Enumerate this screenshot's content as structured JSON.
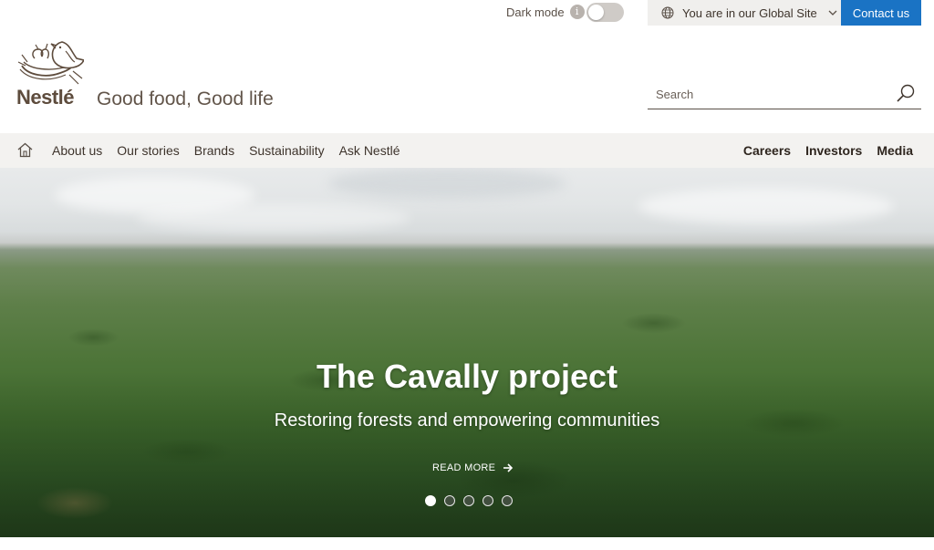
{
  "utility": {
    "dark_mode_label": "Dark mode",
    "info_glyph": "i",
    "site_label": "You are in our Global Site",
    "contact_label": "Contact us"
  },
  "header": {
    "logo_text": "Nestlé",
    "tagline": "Good food, Good life",
    "search_placeholder": "Search"
  },
  "nav": {
    "left": [
      "About us",
      "Our stories",
      "Brands",
      "Sustainability",
      "Ask Nestlé"
    ],
    "right": [
      "Careers",
      "Investors",
      "Media"
    ]
  },
  "hero": {
    "title": "The Cavally project",
    "subtitle": "Restoring forests and empowering communities",
    "read_more": "READ MORE",
    "slide_count": 5,
    "active_slide": 1
  },
  "colors": {
    "accent": "#1a73c4",
    "brand_brown": "#5e4c3d"
  },
  "icons": [
    "info-icon",
    "globe-icon",
    "chevron-down-icon",
    "search-icon",
    "home-icon",
    "arrow-right-icon"
  ]
}
